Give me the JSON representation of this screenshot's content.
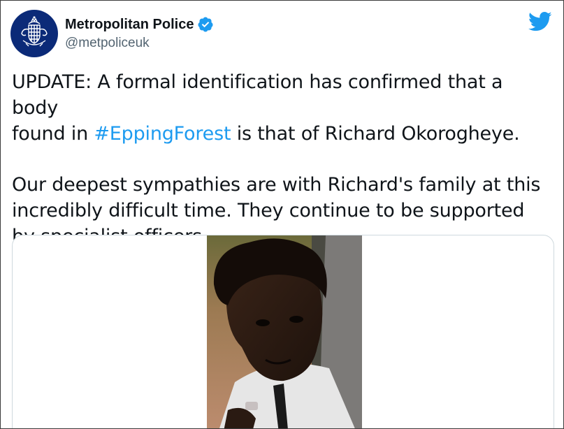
{
  "tweet": {
    "display_name": "Metropolitan Police",
    "handle": "@metpoliceuk",
    "text_line1_pre": "UPDATE: A formal identification has confirmed that a body",
    "text_line2_pre": "found in ",
    "hashtag": "#EppingForest",
    "text_line2_post": " is that of Richard Okorogheye.",
    "paragraph2": "Our deepest sympathies are with Richard's family at this incredibly difficult time. They continue to be supported by specialist officers."
  },
  "icons": {
    "avatar": "metropolitan-police-crest",
    "verified": "verified-badge-icon",
    "brand": "twitter-bird-icon"
  },
  "colors": {
    "accent": "#1d9bf0",
    "text": "#0f1419",
    "secondary": "#536471",
    "avatar_bg": "#0b2a78"
  }
}
